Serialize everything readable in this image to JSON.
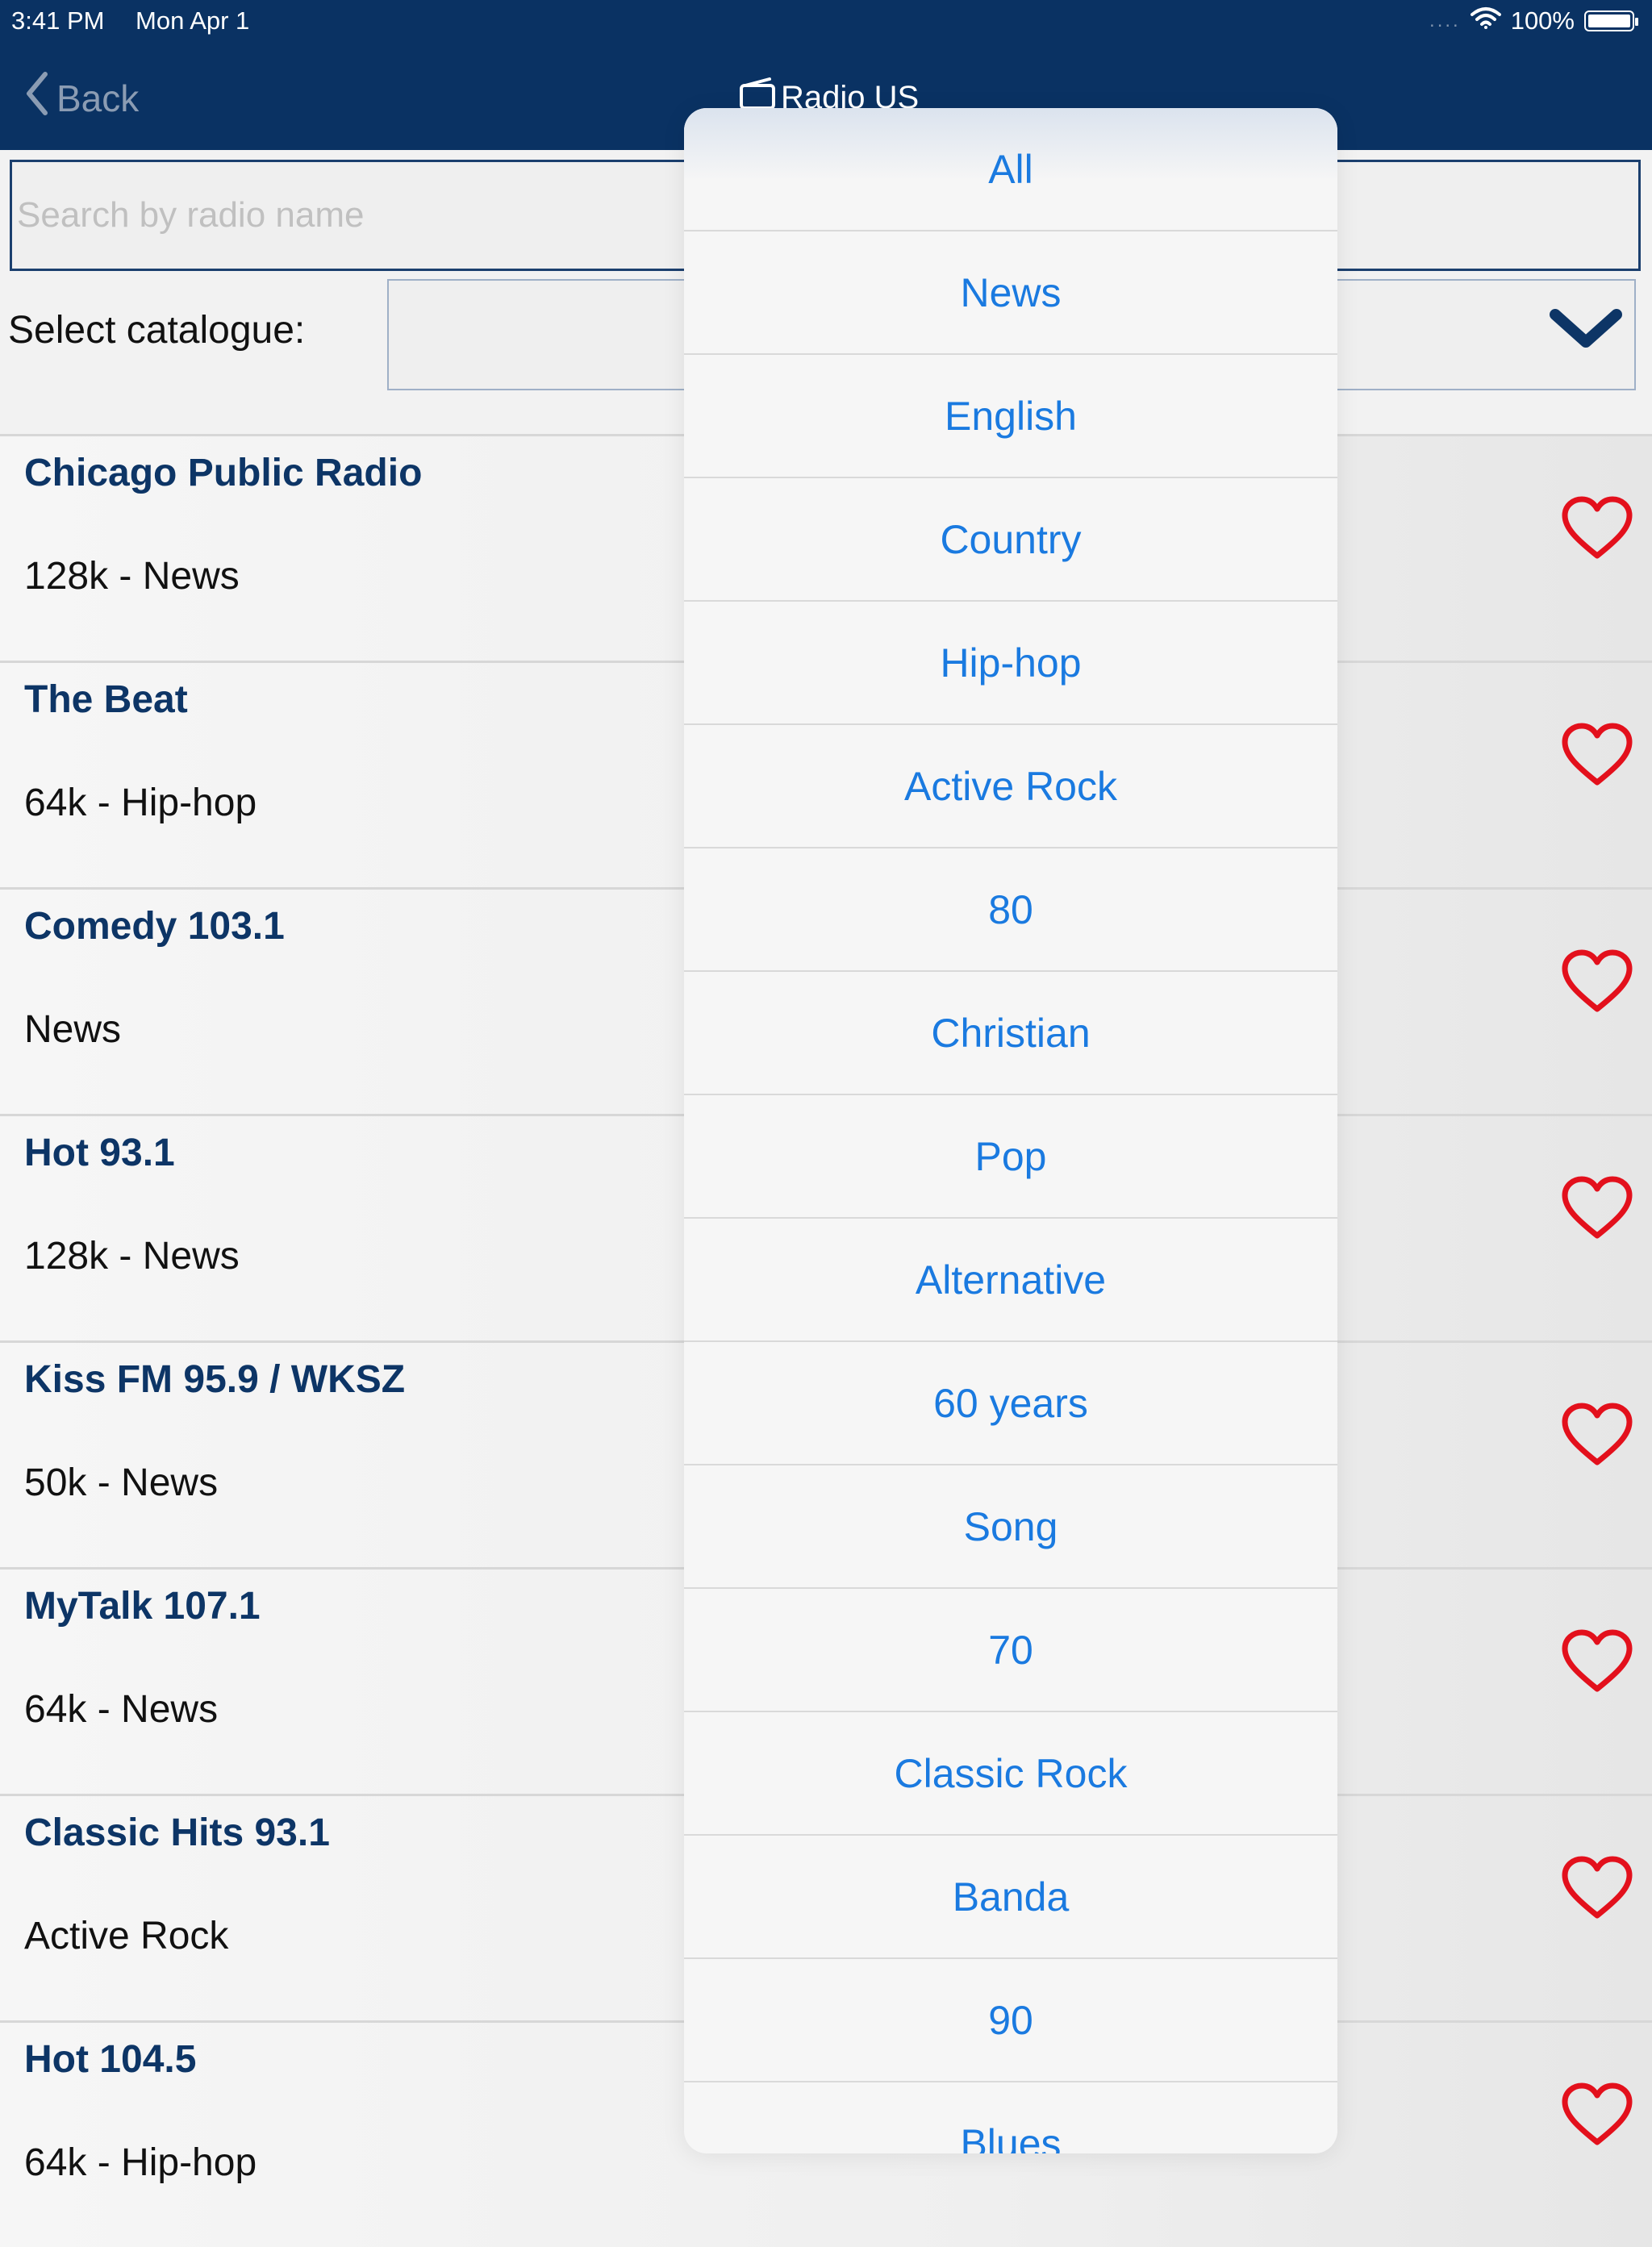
{
  "status_bar": {
    "time": "3:41 PM",
    "date": "Mon Apr 1",
    "battery": "100%",
    "signal_dots": "....",
    "battery_level": 1.0
  },
  "nav": {
    "back_label": "Back",
    "title": "Radio US"
  },
  "search": {
    "placeholder": "Search by radio name",
    "value": ""
  },
  "catalogue": {
    "label": "Select catalogue:",
    "selected": ""
  },
  "stations": [
    {
      "name": "Chicago Public Radio",
      "desc": "128k - News",
      "favorite": false
    },
    {
      "name": "The Beat",
      "desc": "64k - Hip-hop",
      "favorite": false
    },
    {
      "name": "Comedy 103.1",
      "desc": "News",
      "favorite": false
    },
    {
      "name": "Hot 93.1",
      "desc": "128k - News",
      "favorite": false
    },
    {
      "name": "Kiss FM 95.9 / WKSZ",
      "desc": "50k - News",
      "favorite": false
    },
    {
      "name": "MyTalk 107.1",
      "desc": "64k - News",
      "favorite": false
    },
    {
      "name": "Classic Hits 93.1",
      "desc": "Active Rock",
      "favorite": false
    },
    {
      "name": "Hot 104.5",
      "desc": "64k - Hip-hop",
      "favorite": false
    }
  ],
  "dropdown": {
    "options": [
      "All",
      "News",
      "English",
      "Country",
      "Hip-hop",
      "Active Rock",
      "80",
      "Christian",
      "Pop",
      "Alternative",
      "60 years",
      "Song",
      "70",
      "Classic Rock",
      "Banda",
      "90",
      "Blues"
    ]
  },
  "colors": {
    "nav_background": "#0a3263",
    "station_name": "#0d3566",
    "option_text": "#1a7ae0",
    "heart": "#e3101c",
    "chevron": "#0d3566"
  }
}
